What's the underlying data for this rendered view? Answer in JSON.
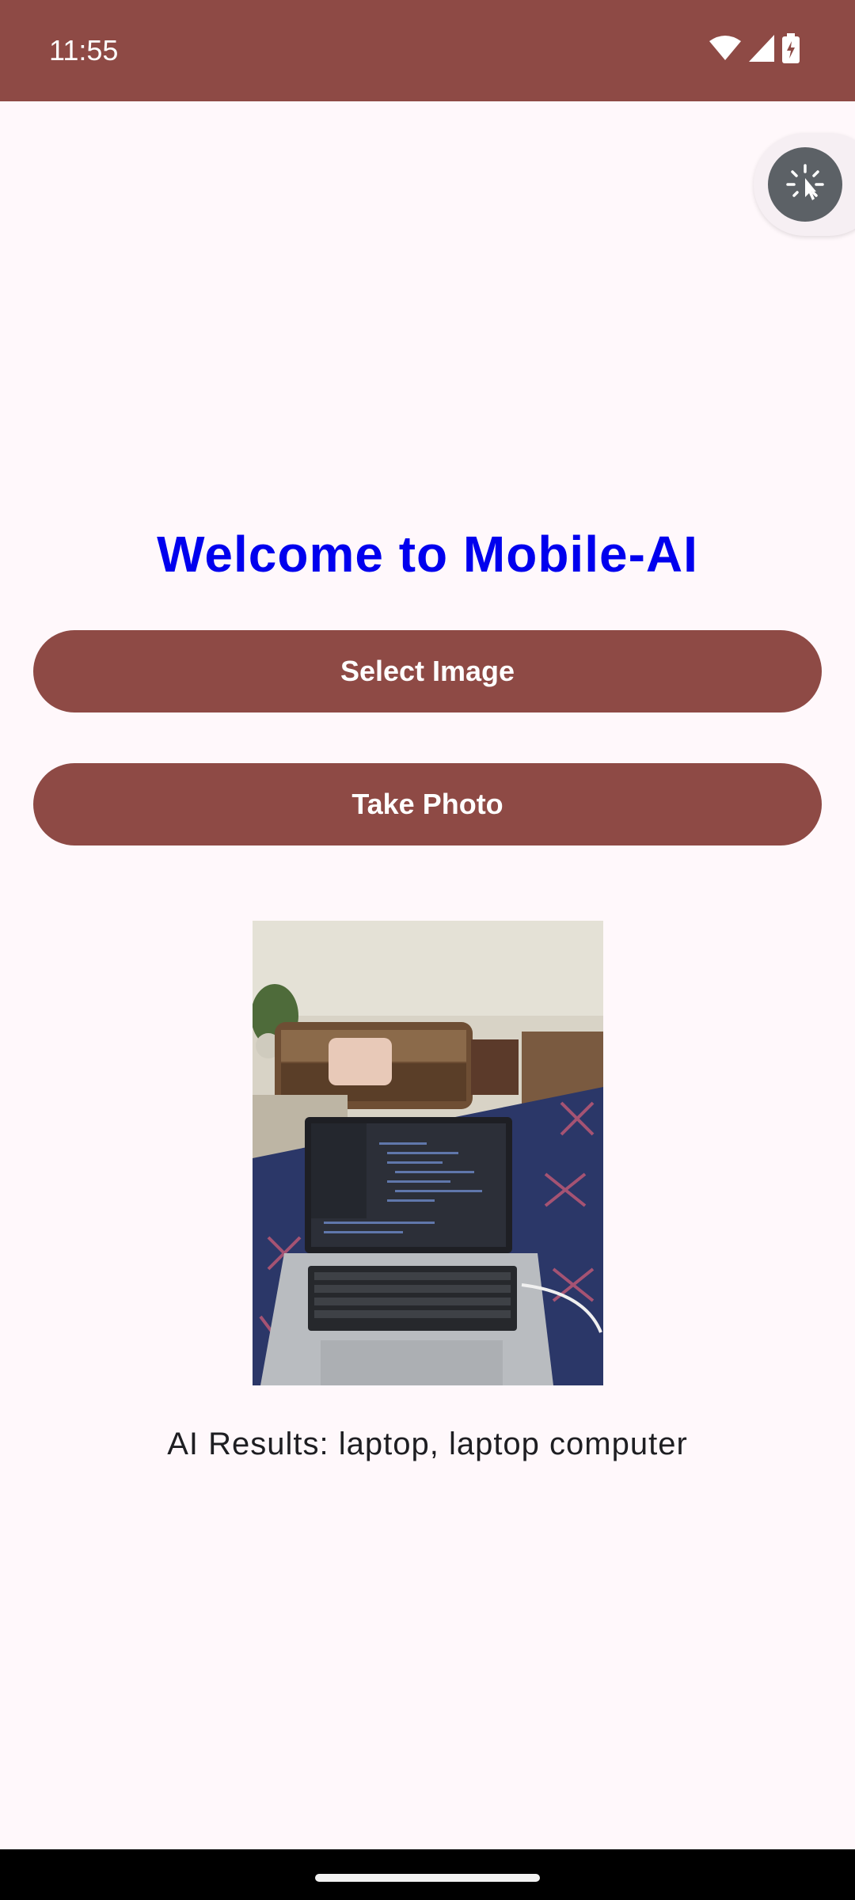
{
  "status_bar": {
    "time": "11:55",
    "icons": [
      "wifi-icon",
      "cell-signal-icon",
      "battery-charging-icon"
    ],
    "background": "#8E4A45"
  },
  "floating_button": {
    "icon": "tap-sparkle-icon"
  },
  "main": {
    "title": "Welcome to Mobile-AI",
    "title_color": "#0000EE",
    "select_image_label": "Select Image",
    "take_photo_label": "Take Photo",
    "button_color": "#8E4A45",
    "image_subject": "laptop-on-bed-photo",
    "results_text": "AI Results: laptop, laptop computer"
  }
}
